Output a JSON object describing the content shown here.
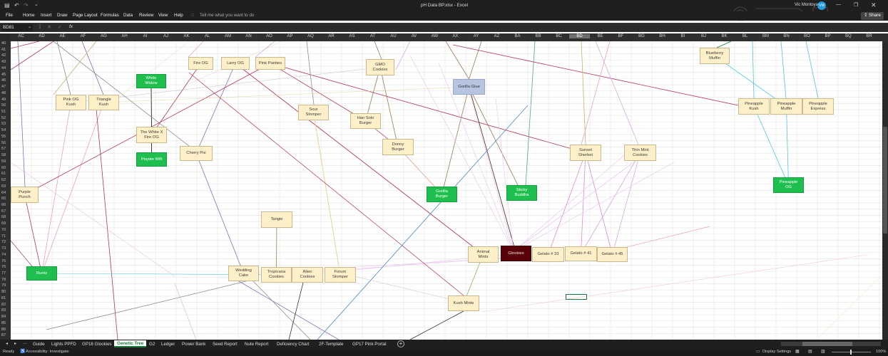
{
  "title_bar": {
    "doc_title": "pH Data BP.xlsx  -  Excel",
    "user": "Vic Montoya",
    "user_initials": "VM",
    "qat_save_icon": "save-icon",
    "qat_undo_icon": "undo-icon",
    "qat_redo_icon": "redo-icon"
  },
  "menu": {
    "items": [
      "File",
      "Home",
      "Insert",
      "Draw",
      "Page Layout",
      "Formulas",
      "Data",
      "Review",
      "View",
      "Help"
    ],
    "tell_me": "Tell me what you want to do",
    "share": "Share"
  },
  "formula_bar": {
    "name_box": "BD81",
    "fx": "fx",
    "value": ""
  },
  "columns": [
    "AC",
    "AD",
    "AE",
    "AF",
    "AG",
    "AH",
    "AI",
    "AJ",
    "AK",
    "AL",
    "AM",
    "AN",
    "AO",
    "AP",
    "AQ",
    "AR",
    "AS",
    "AT",
    "AU",
    "AV",
    "AW",
    "AX",
    "AY",
    "AZ",
    "BA",
    "BB",
    "BC",
    "BD",
    "BE",
    "BF",
    "BG",
    "BH",
    "BI",
    "BJ",
    "BK",
    "BL",
    "BM",
    "BN",
    "BO",
    "BP",
    "BQ",
    "BR"
  ],
  "selected_column": "BD",
  "rows": [
    "40",
    "41",
    "42",
    "43",
    "44",
    "45",
    "46",
    "47",
    "48",
    "49",
    "50",
    "51",
    "52",
    "53",
    "54",
    "55",
    "56",
    "57",
    "58",
    "59",
    "60",
    "61",
    "62",
    "63",
    "64",
    "65",
    "66",
    "67",
    "68",
    "69",
    "70",
    "71",
    "72",
    "73",
    "74",
    "75",
    "76",
    "77",
    "78",
    "79",
    "80",
    "81",
    "82",
    "83",
    "84",
    "85",
    "86",
    "87"
  ],
  "nodes": [
    {
      "label": "White\nWidow",
      "style": "green"
    },
    {
      "label": "Fire OG",
      "style": "tan"
    },
    {
      "label": "Larry OG",
      "style": "tan"
    },
    {
      "label": "Pink Panties",
      "style": "tan"
    },
    {
      "label": "GMO\nCookies",
      "style": "tan"
    },
    {
      "label": "Gorilla Glue",
      "style": "blue"
    },
    {
      "label": "Blueberry\nMuffin",
      "style": "tan"
    },
    {
      "label": "Pink OG\nKush",
      "style": "tan"
    },
    {
      "label": "Triangle\nKush",
      "style": "tan"
    },
    {
      "label": "Sour\nStomper",
      "style": "tan"
    },
    {
      "label": "Han Solo\nBurger",
      "style": "tan"
    },
    {
      "label": "Pineapple\nKush",
      "style": "tan"
    },
    {
      "label": "Pineapple\nMuffin",
      "style": "tan"
    },
    {
      "label": "Pineapple\nExpress",
      "style": "tan"
    },
    {
      "label": "The White  X\nFire OG",
      "style": "tan"
    },
    {
      "label": "Donny\nBurger",
      "style": "tan"
    },
    {
      "label": "Cherry Pie",
      "style": "tan"
    },
    {
      "label": "Sunset\nSherbet",
      "style": "tan"
    },
    {
      "label": "Thin Mint\nCookies",
      "style": "tan"
    },
    {
      "label": "Peyote Wifi",
      "style": "green"
    },
    {
      "label": "Pineapple\nOG",
      "style": "green"
    },
    {
      "label": "Gorilla\nBurger",
      "style": "green"
    },
    {
      "label": "Sticky\nBuddha",
      "style": "green"
    },
    {
      "label": "Purple\nPunch",
      "style": "tan"
    },
    {
      "label": "Tangie",
      "style": "tan"
    },
    {
      "label": "Animal\nMints",
      "style": "tan"
    },
    {
      "label": "Glookies",
      "style": "maroon"
    },
    {
      "label": "Gelato # 33",
      "style": "tan"
    },
    {
      "label": "Gelato # 41",
      "style": "tan"
    },
    {
      "label": "Gelato # 45",
      "style": "tan"
    },
    {
      "label": "Runtz",
      "style": "green"
    },
    {
      "label": "Wedding\nCake",
      "style": "tan"
    },
    {
      "label": "Tropicana\nCookies",
      "style": "tan"
    },
    {
      "label": "Alien\nCookies",
      "style": "tan"
    },
    {
      "label": "Forum\nStomper",
      "style": "tan"
    },
    {
      "label": "Kush Mints",
      "style": "tan"
    }
  ],
  "sheet_tabs": [
    "Guide",
    "Lights PPFD",
    "GP18 Glookies",
    "Genetic Tree",
    "G2",
    "Ledger",
    "Power Bank",
    "Seed Report",
    "Nute Report",
    "Deficiency Chart",
    "2F-Template",
    "GP17 Pink Portal"
  ],
  "active_tab": "Genetic Tree",
  "status": {
    "ready": "Ready",
    "accessibility": "Accessibility: Investigate",
    "display_settings": "Display Settings",
    "zoom": "100%"
  }
}
